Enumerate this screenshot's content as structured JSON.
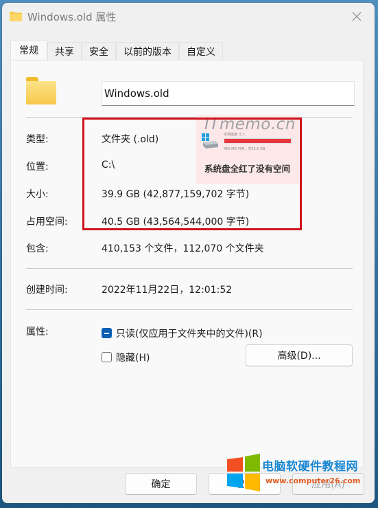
{
  "window": {
    "title": "Windows.old 属性",
    "title_icon": "folder-icon",
    "close_icon": "close-icon"
  },
  "tabs": [
    {
      "label": "常规",
      "active": true
    },
    {
      "label": "共享",
      "active": false
    },
    {
      "label": "安全",
      "active": false
    },
    {
      "label": "以前的版本",
      "active": false
    },
    {
      "label": "自定义",
      "active": false
    }
  ],
  "general": {
    "name_value": "Windows.old",
    "rows": {
      "type": {
        "label": "类型:",
        "value": "文件夹 (.old)"
      },
      "location": {
        "label": "位置:",
        "value": "C:\\"
      },
      "size": {
        "label": "大小:",
        "value": "39.9 GB (42,877,159,702 字节)"
      },
      "size_on_disk": {
        "label": "占用空间:",
        "value": "40.5 GB (43,564,544,000 字节)"
      },
      "contains": {
        "label": "包含:",
        "value": "410,153 个文件，112,070 个文件夹"
      },
      "created": {
        "label": "创建时间:",
        "value": "2022年11月22日，12:01:52"
      },
      "attributes": {
        "label": "属性:"
      }
    },
    "attributes": {
      "readonly": {
        "label": "只读(仅应用于文件夹中的文件)(R)",
        "state": "indeterminate"
      },
      "hidden": {
        "label": "隐藏(H)",
        "state": "unchecked"
      },
      "advanced_button": "高级(D)..."
    }
  },
  "footer": {
    "ok": "确定",
    "cancel": "取消",
    "apply": "应用(A)",
    "apply_enabled": false
  },
  "highlight_color": "#d0121b",
  "watermark_itmemo": {
    "brand": "ITmemo.cn",
    "drive_label": "本地磁盘 (C:)",
    "drive_free": "460 MB 可用，共52.0 GB",
    "drive_used_fraction": 0.99,
    "caption": "系统盘全红了没有空间"
  },
  "watermark_site": {
    "name": "电脑软硬件教程网",
    "url": "www.computer26.com"
  }
}
